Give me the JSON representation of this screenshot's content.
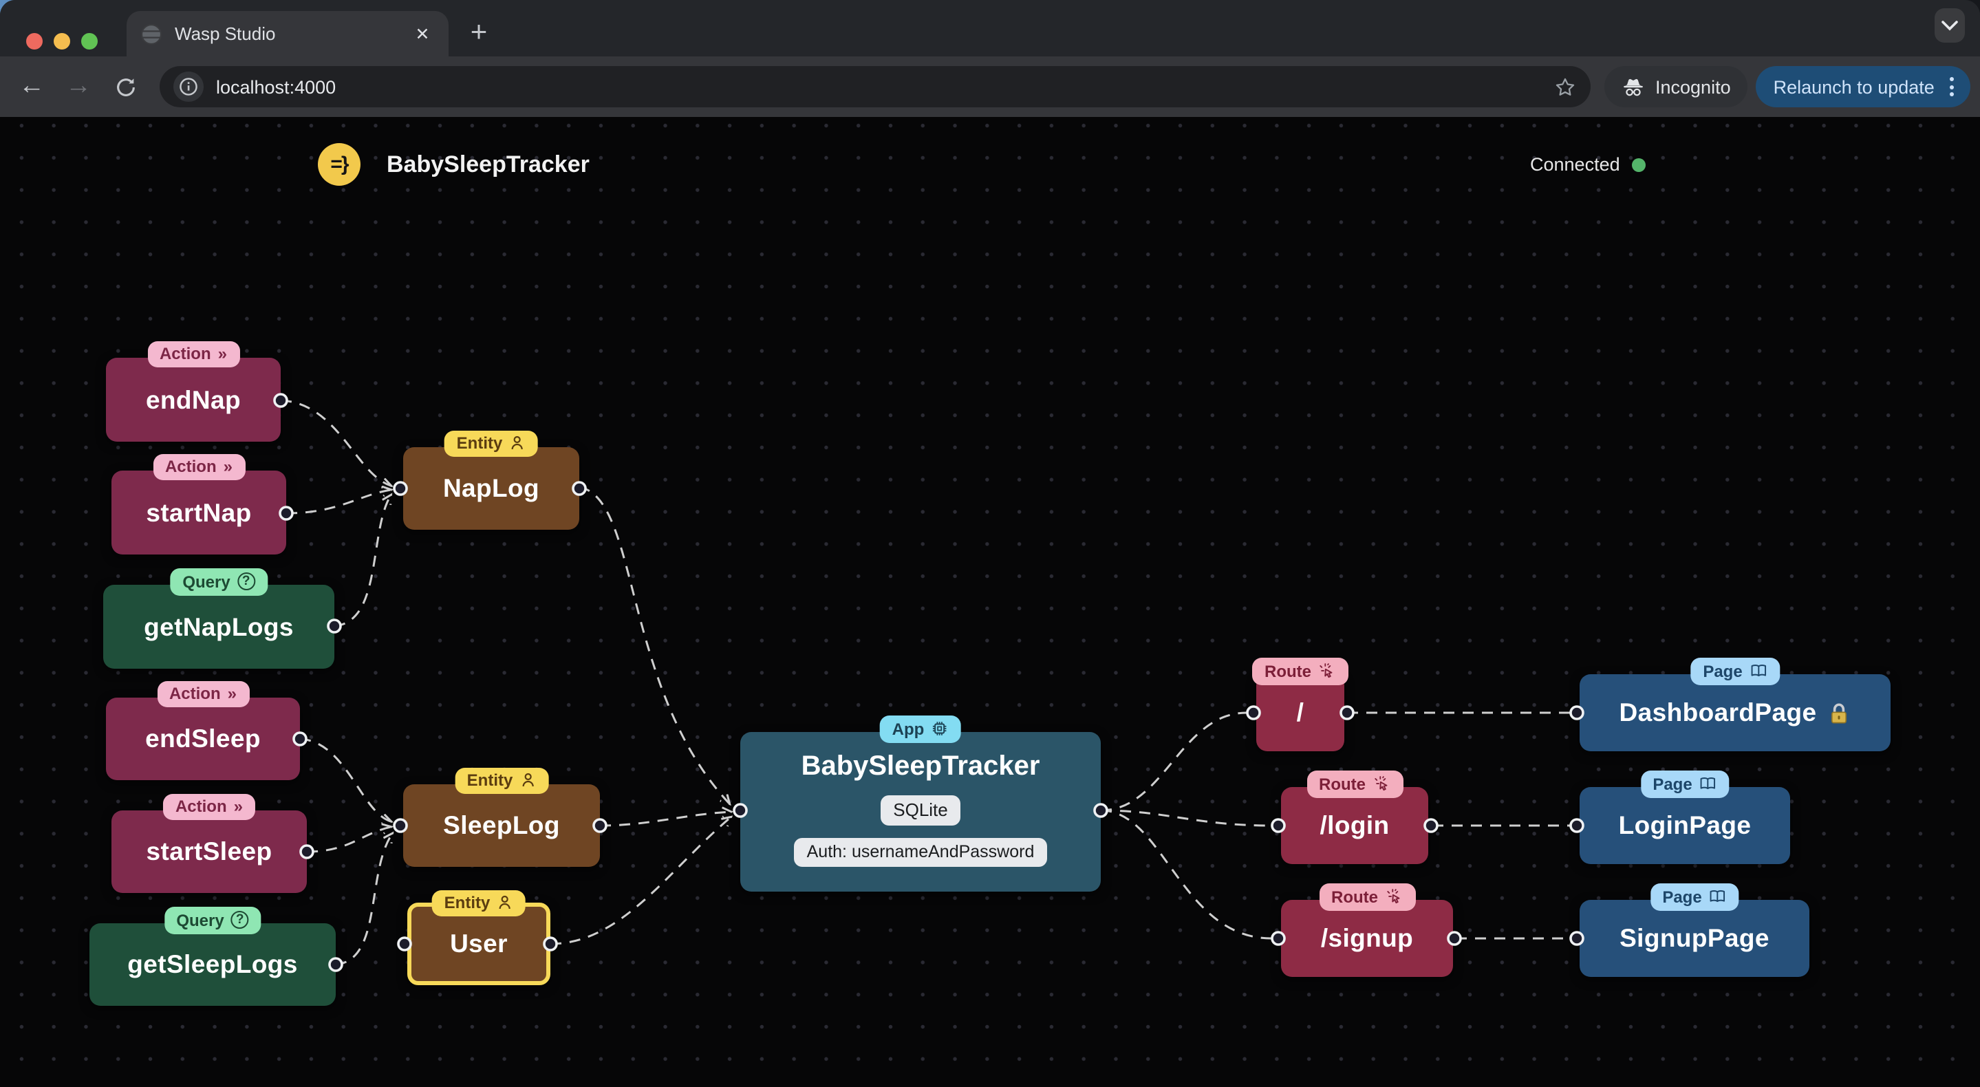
{
  "browser": {
    "tab": {
      "title": "Wasp Studio"
    },
    "toolbar": {
      "url": "localhost:4000",
      "incognito_label": "Incognito",
      "relaunch_label": "Relaunch to update"
    }
  },
  "header": {
    "logo_glyph": "=}",
    "app_name": "BabySleepTracker",
    "status": {
      "label": "Connected",
      "color": "#54b46a"
    }
  },
  "badges": {
    "action": "Action",
    "query": "Query",
    "entity": "Entity",
    "app": "App",
    "route": "Route",
    "page": "Page"
  },
  "canvas": {
    "actions": [
      {
        "label": "endNap"
      },
      {
        "label": "startNap"
      },
      {
        "label": "endSleep"
      },
      {
        "label": "startSleep"
      }
    ],
    "queries": [
      {
        "label": "getNapLogs"
      },
      {
        "label": "getSleepLogs"
      }
    ],
    "entities": [
      {
        "label": "NapLog"
      },
      {
        "label": "SleepLog"
      },
      {
        "label": "User",
        "selected": true
      }
    ],
    "app": {
      "label": "BabySleepTracker",
      "db": "SQLite",
      "auth": "Auth: usernameAndPassword"
    },
    "routes": [
      {
        "label": "/"
      },
      {
        "label": "/login"
      },
      {
        "label": "/signup"
      }
    ],
    "pages": [
      {
        "label": "DashboardPage",
        "locked": true
      },
      {
        "label": "LoginPage"
      },
      {
        "label": "SignupPage"
      }
    ]
  },
  "colors": {
    "action": "#7e2a4c",
    "query": "#1f4f3a",
    "entity": "#6f4523",
    "app": "#2b5568",
    "route": "#8e2b45",
    "page": "#26507a",
    "badge_action": "#f4b8cf",
    "badge_query": "#8fe6b3",
    "badge_entity": "#f7d959",
    "badge_app": "#83dcf2",
    "badge_route": "#f3aebe",
    "badge_page": "#a8d8f8",
    "selection": "#f7d959",
    "logo": "#f2c94c",
    "relaunch_button": "#1e4d76",
    "canvas_bg": "#060607",
    "edge": "#cfcfcf"
  }
}
